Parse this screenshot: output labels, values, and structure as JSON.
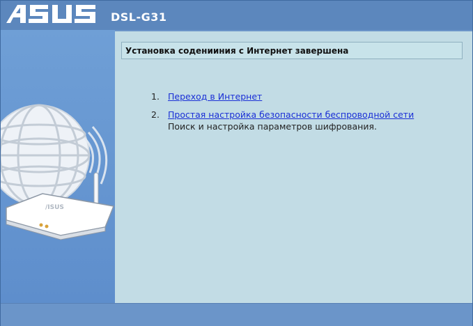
{
  "header": {
    "brand": "ASUS",
    "model": "DSL-G31"
  },
  "main": {
    "title": "Установка соденииния с Интернет завершена",
    "items": [
      {
        "number": "1.",
        "label": "Переход в Интернет",
        "description": ""
      },
      {
        "number": "2.",
        "label": "Простая настройка безопасности беспроводной сети",
        "description": "Поиск и настройка параметров шифрования."
      }
    ]
  },
  "colors": {
    "header": "#5c87bd",
    "sidebar": "#6b95c9",
    "content": "#c2dce5",
    "link": "#1a2fd6"
  },
  "icons": [
    "asus-logo",
    "globe-router-illustration"
  ]
}
